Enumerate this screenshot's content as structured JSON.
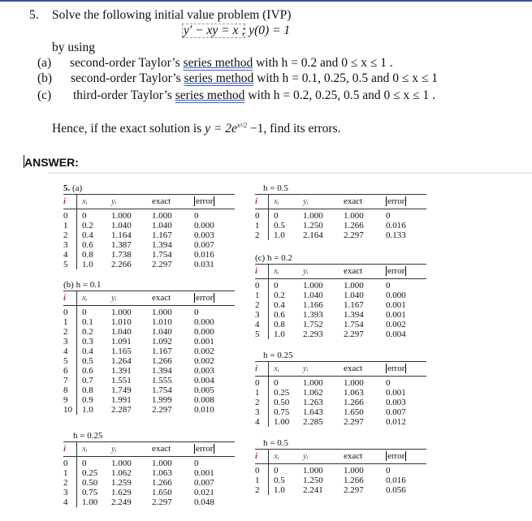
{
  "question": {
    "number": "5.",
    "intro": "Solve the following initial value problem (IVP)",
    "equation": "y′ − xy = x ;     y(0) = 1",
    "by_using": "by using",
    "parts": [
      {
        "label": "(a)",
        "pre": "second-order Taylor’s ",
        "method": "series  method",
        "post": " with h = 0.2 and 0 ≤ x ≤ 1 ."
      },
      {
        "label": "(b)",
        "pre": "second-order Taylor’s ",
        "method": "series  method",
        "post": " with h = 0.1, 0.25, 0.5 and 0 ≤ x ≤ 1"
      },
      {
        "label": "(c)",
        "pre": "third-order Taylor’s ",
        "method": "series  method",
        "post": " with h = 0.2, 0.25, 0.5 and 0 ≤ x ≤ 1 ."
      }
    ],
    "hence_pre": "Hence, if the exact solution is ",
    "exact_solution": "y = 2e",
    "exponent": "x²/2",
    "hence_post": " −1, find its errors."
  },
  "answer_label": "ANSWER:",
  "headers": {
    "i": "i",
    "x": "xᵢ",
    "y": "yᵢ",
    "exact": "exact",
    "error": "error"
  },
  "tables": {
    "a": {
      "caption_bold": "5.",
      "caption": " (a)",
      "rows": [
        [
          "0",
          "0",
          "1.000",
          "1.000",
          "0"
        ],
        [
          "1",
          "0.2",
          "1.040",
          "1.040",
          "0.000"
        ],
        [
          "2",
          "0.4",
          "1.164",
          "1.167",
          "0.003"
        ],
        [
          "3",
          "0.6",
          "1.387",
          "1.394",
          "0.007"
        ],
        [
          "4",
          "0.8",
          "1.738",
          "1.754",
          "0.016"
        ],
        [
          "5",
          "1.0",
          "2.266",
          "2.297",
          "0.031"
        ]
      ]
    },
    "b1": {
      "caption": "(b)  h = 0.1",
      "rows": [
        [
          "0",
          "0",
          "1.000",
          "1.000",
          "0"
        ],
        [
          "1",
          "0.1",
          "1.010",
          "1.010",
          "0.000"
        ],
        [
          "2",
          "0.2",
          "1.040",
          "1.040",
          "0.000"
        ],
        [
          "3",
          "0.3",
          "1.091",
          "1.092",
          "0.001"
        ],
        [
          "4",
          "0.4",
          "1.165",
          "1.167",
          "0.002"
        ],
        [
          "5",
          "0.5",
          "1.264",
          "1.266",
          "0.002"
        ],
        [
          "6",
          "0.6",
          "1.391",
          "1.394",
          "0.003"
        ],
        [
          "7",
          "0.7",
          "1.551",
          "1.555",
          "0.004"
        ],
        [
          "8",
          "0.8",
          "1.749",
          "1.754",
          "0.005"
        ],
        [
          "9",
          "0.9",
          "1.991",
          "1.999",
          "0.008"
        ],
        [
          "10",
          "1.0",
          "2.287",
          "2.297",
          "0.010"
        ]
      ]
    },
    "b2": {
      "caption": "h = 0.25",
      "rows": [
        [
          "0",
          "0",
          "1.000",
          "1.000",
          "0"
        ],
        [
          "1",
          "0.25",
          "1.062",
          "1.063",
          "0.001"
        ],
        [
          "2",
          "0.50",
          "1.259",
          "1.266",
          "0.007"
        ],
        [
          "3",
          "0.75",
          "1.629",
          "1.650",
          "0.021"
        ],
        [
          "4",
          "1.00",
          "2.249",
          "2.297",
          "0.048"
        ]
      ]
    },
    "b3": {
      "caption": "h = 0.5",
      "rows": [
        [
          "0",
          "0",
          "1.000",
          "1.000",
          "0"
        ],
        [
          "1",
          "0.5",
          "1.250",
          "1.266",
          "0.016"
        ],
        [
          "2",
          "1.0",
          "2.164",
          "2.297",
          "0.133"
        ]
      ]
    },
    "c1": {
      "caption": "(c)  h = 0.2",
      "rows": [
        [
          "0",
          "0",
          "1.000",
          "1.000",
          "0"
        ],
        [
          "1",
          "0.2",
          "1.040",
          "1.040",
          "0.000"
        ],
        [
          "2",
          "0.4",
          "1.166",
          "1.167",
          "0.001"
        ],
        [
          "3",
          "0.6",
          "1.393",
          "1.394",
          "0.001"
        ],
        [
          "4",
          "0.8",
          "1.752",
          "1.754",
          "0.002"
        ],
        [
          "5",
          "1.0",
          "2.293",
          "2.297",
          "0.004"
        ]
      ]
    },
    "c2": {
      "caption": "h = 0.25",
      "rows": [
        [
          "0",
          "0",
          "1.000",
          "1.000",
          "0"
        ],
        [
          "1",
          "0.25",
          "1.062",
          "1.063",
          "0.001"
        ],
        [
          "2",
          "0.50",
          "1.263",
          "1.266",
          "0.003"
        ],
        [
          "3",
          "0.75",
          "1.643",
          "1.650",
          "0.007"
        ],
        [
          "4",
          "1.00",
          "2.285",
          "2.297",
          "0.012"
        ]
      ]
    },
    "c3": {
      "caption": "h = 0.5",
      "rows": [
        [
          "0",
          "0",
          "1.000",
          "1.000",
          "0"
        ],
        [
          "1",
          "0.5",
          "1.250",
          "1.266",
          "0.016"
        ],
        [
          "2",
          "1.0",
          "2.241",
          "2.297",
          "0.056"
        ]
      ]
    }
  }
}
